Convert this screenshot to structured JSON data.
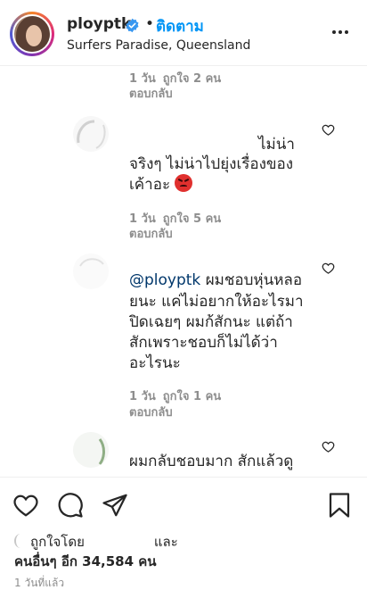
{
  "header": {
    "username": "ployptk",
    "separator": "•",
    "follow_label": "ติดตาม",
    "location": "Surfers Paradise, Queensland"
  },
  "comments": [
    {
      "meta_time": "1 วัน",
      "meta_likes": "ถูกใจ 2 คน",
      "reply_label": "ตอบกลับ"
    },
    {
      "text_lines": [
        "ไม่น่า",
        "จริงๆ ไม่น่าไปยุ่งเรื่องของ",
        "เค้าอะ"
      ],
      "emoji": "angry-face",
      "meta_time": "1 วัน",
      "meta_likes": "ถูกใจ 5 คน",
      "reply_label": "ตอบกลับ"
    },
    {
      "mention": "@ployptk",
      "text_lines": [
        "ผมชอบหุ่นหลอ",
        "ยนะ แค่ไม่อยากให้อะไรมา",
        "ปิดเฉยๆ ผมก้สักนะ แต่ถ้า",
        "สักเพราะชอบก็ไม่ได้ว่า",
        "อะไรนะ"
      ],
      "meta_time": "1 วัน",
      "meta_likes": "ถูกใจ 1 คน",
      "reply_label": "ตอบกลับ"
    },
    {
      "text_lines": [
        "ผมกลับชอบมาก สักแล้วดู"
      ]
    }
  ],
  "footer": {
    "liked_by_prefix": "ถูกใจโดย",
    "liked_by_suffix": "และ",
    "others_label": "คนอื่นๆ อีก 34,584 คน",
    "time_ago": "1 วันที่แล้ว"
  },
  "colors": {
    "accent": "#0095f6",
    "verified": "#3897f0",
    "muted": "#8e8e8e",
    "text": "#262626"
  },
  "icons": [
    "verified-badge-icon",
    "more-options-icon",
    "heart-icon",
    "comment-icon",
    "share-icon",
    "bookmark-icon"
  ]
}
